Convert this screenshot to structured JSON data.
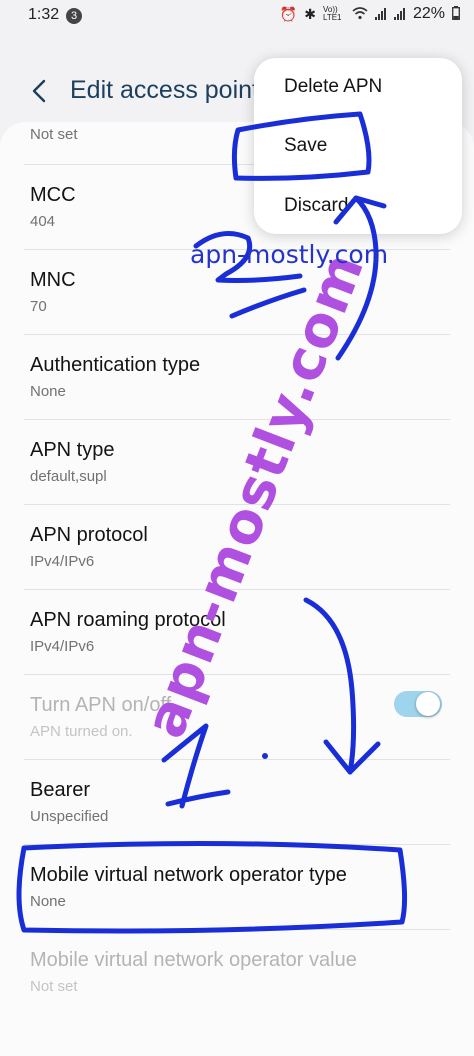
{
  "status_bar": {
    "time": "1:32",
    "notification_count": "3",
    "network_label": "Vo)) LTE1",
    "battery": "22%"
  },
  "header": {
    "title": "Edit access point",
    "back_icon": "chevron-left-icon"
  },
  "menu": {
    "items": [
      {
        "label": "Delete APN"
      },
      {
        "label": "Save"
      },
      {
        "label": "Discard"
      }
    ]
  },
  "settings": {
    "items": [
      {
        "label": "",
        "value": "Not set"
      },
      {
        "label": "MCC",
        "value": "404"
      },
      {
        "label": "MNC",
        "value": "70"
      },
      {
        "label": "Authentication type",
        "value": "None"
      },
      {
        "label": "APN type",
        "value": "default,supl"
      },
      {
        "label": "APN protocol",
        "value": "IPv4/IPv6"
      },
      {
        "label": "APN roaming protocol",
        "value": "IPv4/IPv6"
      },
      {
        "label": "Turn APN on/off",
        "value": "APN turned on.",
        "toggle_on": true,
        "disabled": true
      },
      {
        "label": "Bearer",
        "value": "Unspecified"
      },
      {
        "label": "Mobile virtual network operator type",
        "value": "None"
      },
      {
        "label": "Mobile virtual network operator value",
        "value": "Not set",
        "disabled": true
      }
    ]
  },
  "watermark": {
    "diagonal": "apn-mostly.com",
    "top": "apn-mostly.com"
  },
  "colors": {
    "accent": "#1b3f5c",
    "toggle_track": "#9ed4ec",
    "annotation_ink": "#1a2ed8",
    "watermark": "#b050e0"
  }
}
